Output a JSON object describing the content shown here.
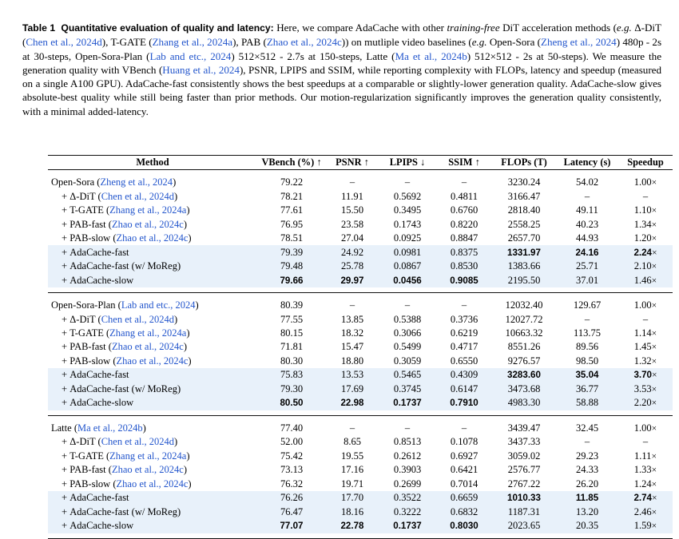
{
  "caption": {
    "label": "Table 1",
    "title": "Quantitative evaluation of quality and latency:",
    "body_html": "Here, we compare AdaCache with other <i>training-free</i> DiT acceleration methods (<i>e.g.</i> Δ-DiT (<c>Chen et al., 2024d</c>), T-GATE (<c>Zhang et al., 2024a</c>), PAB (<c>Zhao et al., 2024c</c>)) on mutliple video baselines (<i>e.g.</i> Open-Sora (<c>Zheng et al., 2024</c>) 480p - 2s at 30-steps, Open-Sora-Plan (<c>Lab and etc., 2024</c>) 512×512 - 2.7s at 150-steps, Latte (<c>Ma et al., 2024b</c>) 512×512 - 2s at 50-steps). We measure the generation quality with VBench (<c>Huang et al., 2024</c>), PSNR, LPIPS and SSIM, while reporting complexity with FLOPs, latency and speedup (measured on a single A100 GPU). AdaCache-fast consistently shows the best speedups at a comparable or slightly-lower generation quality. AdaCache-slow gives absolute-best quality while still being faster than prior methods. Our motion-regularization significantly improves the generation quality consistently, with a minimal added-latency.",
    "citation_color": "#2255cc"
  },
  "table": {
    "columns": [
      {
        "key": "method",
        "label": "Method",
        "align": "left"
      },
      {
        "key": "vbench",
        "label": "VBench (%) ↑",
        "align": "center"
      },
      {
        "key": "psnr",
        "label": "PSNR ↑",
        "align": "center"
      },
      {
        "key": "lpips",
        "label": "LPIPS ↓",
        "align": "center"
      },
      {
        "key": "ssim",
        "label": "SSIM ↑",
        "align": "center"
      },
      {
        "key": "flops",
        "label": "FLOPs (T)",
        "align": "center"
      },
      {
        "key": "latency",
        "label": "Latency (s)",
        "align": "center"
      },
      {
        "key": "speedup",
        "label": "Speedup",
        "align": "center"
      }
    ],
    "highlight_color": "#e8f1fa",
    "blocks": [
      {
        "id": "open-sora",
        "rows": [
          {
            "method_name": "Open-Sora",
            "method_cite": "Zheng et al., 2024",
            "indent": false,
            "plus": false,
            "vbench": "79.22",
            "psnr": "–",
            "lpips": "–",
            "ssim": "–",
            "flops": "3230.24",
            "latency": "54.02",
            "speedup": "1.00×",
            "highlight": false,
            "bold": []
          },
          {
            "method_name": "Δ-DiT",
            "method_cite": "Chen et al., 2024d",
            "indent": true,
            "plus": true,
            "vbench": "78.21",
            "psnr": "11.91",
            "lpips": "0.5692",
            "ssim": "0.4811",
            "flops": "3166.47",
            "latency": "–",
            "speedup": "–",
            "highlight": false,
            "bold": []
          },
          {
            "method_name": "T-GATE",
            "method_cite": "Zhang et al., 2024a",
            "indent": true,
            "plus": true,
            "vbench": "77.61",
            "psnr": "15.50",
            "lpips": "0.3495",
            "ssim": "0.6760",
            "flops": "2818.40",
            "latency": "49.11",
            "speedup": "1.10×",
            "highlight": false,
            "bold": []
          },
          {
            "method_name": "PAB-fast",
            "method_cite": "Zhao et al., 2024c",
            "indent": true,
            "plus": true,
            "vbench": "76.95",
            "psnr": "23.58",
            "lpips": "0.1743",
            "ssim": "0.8220",
            "flops": "2558.25",
            "latency": "40.23",
            "speedup": "1.34×",
            "highlight": false,
            "bold": []
          },
          {
            "method_name": "PAB-slow",
            "method_cite": "Zhao et al., 2024c",
            "indent": true,
            "plus": true,
            "vbench": "78.51",
            "psnr": "27.04",
            "lpips": "0.0925",
            "ssim": "0.8847",
            "flops": "2657.70",
            "latency": "44.93",
            "speedup": "1.20×",
            "highlight": false,
            "bold": []
          },
          {
            "method_name": "AdaCache-fast",
            "method_cite": "",
            "indent": true,
            "plus": true,
            "vbench": "79.39",
            "psnr": "24.92",
            "lpips": "0.0981",
            "ssim": "0.8375",
            "flops": "1331.97",
            "latency": "24.16",
            "speedup": "2.24×",
            "highlight": true,
            "bold": [
              "flops",
              "latency",
              "speedup"
            ]
          },
          {
            "method_name": "AdaCache-fast (w/ MoReg)",
            "method_cite": "",
            "indent": true,
            "plus": true,
            "vbench": "79.48",
            "psnr": "25.78",
            "lpips": "0.0867",
            "ssim": "0.8530",
            "flops": "1383.66",
            "latency": "25.71",
            "speedup": "2.10×",
            "highlight": true,
            "bold": []
          },
          {
            "method_name": "AdaCache-slow",
            "method_cite": "",
            "indent": true,
            "plus": true,
            "vbench": "79.66",
            "psnr": "29.97",
            "lpips": "0.0456",
            "ssim": "0.9085",
            "flops": "2195.50",
            "latency": "37.01",
            "speedup": "1.46×",
            "highlight": true,
            "bold": [
              "vbench",
              "psnr",
              "lpips",
              "ssim"
            ]
          }
        ]
      },
      {
        "id": "open-sora-plan",
        "rows": [
          {
            "method_name": "Open-Sora-Plan",
            "method_cite": "Lab and etc., 2024",
            "indent": false,
            "plus": false,
            "vbench": "80.39",
            "psnr": "–",
            "lpips": "–",
            "ssim": "–",
            "flops": "12032.40",
            "latency": "129.67",
            "speedup": "1.00×",
            "highlight": false,
            "bold": []
          },
          {
            "method_name": "Δ-DiT",
            "method_cite": "Chen et al., 2024d",
            "indent": true,
            "plus": true,
            "vbench": "77.55",
            "psnr": "13.85",
            "lpips": "0.5388",
            "ssim": "0.3736",
            "flops": "12027.72",
            "latency": "–",
            "speedup": "–",
            "highlight": false,
            "bold": []
          },
          {
            "method_name": "T-GATE",
            "method_cite": "Zhang et al., 2024a",
            "indent": true,
            "plus": true,
            "vbench": "80.15",
            "psnr": "18.32",
            "lpips": "0.3066",
            "ssim": "0.6219",
            "flops": "10663.32",
            "latency": "113.75",
            "speedup": "1.14×",
            "highlight": false,
            "bold": []
          },
          {
            "method_name": "PAB-fast",
            "method_cite": "Zhao et al., 2024c",
            "indent": true,
            "plus": true,
            "vbench": "71.81",
            "psnr": "15.47",
            "lpips": "0.5499",
            "ssim": "0.4717",
            "flops": "8551.26",
            "latency": "89.56",
            "speedup": "1.45×",
            "highlight": false,
            "bold": []
          },
          {
            "method_name": "PAB-slow",
            "method_cite": "Zhao et al., 2024c",
            "indent": true,
            "plus": true,
            "vbench": "80.30",
            "psnr": "18.80",
            "lpips": "0.3059",
            "ssim": "0.6550",
            "flops": "9276.57",
            "latency": "98.50",
            "speedup": "1.32×",
            "highlight": false,
            "bold": []
          },
          {
            "method_name": "AdaCache-fast",
            "method_cite": "",
            "indent": true,
            "plus": true,
            "vbench": "75.83",
            "psnr": "13.53",
            "lpips": "0.5465",
            "ssim": "0.4309",
            "flops": "3283.60",
            "latency": "35.04",
            "speedup": "3.70×",
            "highlight": true,
            "bold": [
              "flops",
              "latency",
              "speedup"
            ]
          },
          {
            "method_name": "AdaCache-fast (w/ MoReg)",
            "method_cite": "",
            "indent": true,
            "plus": true,
            "vbench": "79.30",
            "psnr": "17.69",
            "lpips": "0.3745",
            "ssim": "0.6147",
            "flops": "3473.68",
            "latency": "36.77",
            "speedup": "3.53×",
            "highlight": true,
            "bold": []
          },
          {
            "method_name": "AdaCache-slow",
            "method_cite": "",
            "indent": true,
            "plus": true,
            "vbench": "80.50",
            "psnr": "22.98",
            "lpips": "0.1737",
            "ssim": "0.7910",
            "flops": "4983.30",
            "latency": "58.88",
            "speedup": "2.20×",
            "highlight": true,
            "bold": [
              "vbench",
              "psnr",
              "lpips",
              "ssim"
            ]
          }
        ]
      },
      {
        "id": "latte",
        "rows": [
          {
            "method_name": "Latte",
            "method_cite": "Ma et al., 2024b",
            "indent": false,
            "plus": false,
            "vbench": "77.40",
            "psnr": "–",
            "lpips": "–",
            "ssim": "–",
            "flops": "3439.47",
            "latency": "32.45",
            "speedup": "1.00×",
            "highlight": false,
            "bold": []
          },
          {
            "method_name": "Δ-DiT",
            "method_cite": "Chen et al., 2024d",
            "indent": true,
            "plus": true,
            "vbench": "52.00",
            "psnr": "8.65",
            "lpips": "0.8513",
            "ssim": "0.1078",
            "flops": "3437.33",
            "latency": "–",
            "speedup": "–",
            "highlight": false,
            "bold": []
          },
          {
            "method_name": "T-GATE",
            "method_cite": "Zhang et al., 2024a",
            "indent": true,
            "plus": true,
            "vbench": "75.42",
            "psnr": "19.55",
            "lpips": "0.2612",
            "ssim": "0.6927",
            "flops": "3059.02",
            "latency": "29.23",
            "speedup": "1.11×",
            "highlight": false,
            "bold": []
          },
          {
            "method_name": "PAB-fast",
            "method_cite": "Zhao et al., 2024c",
            "indent": true,
            "plus": true,
            "vbench": "73.13",
            "psnr": "17.16",
            "lpips": "0.3903",
            "ssim": "0.6421",
            "flops": "2576.77",
            "latency": "24.33",
            "speedup": "1.33×",
            "highlight": false,
            "bold": []
          },
          {
            "method_name": "PAB-slow",
            "method_cite": "Zhao et al., 2024c",
            "indent": true,
            "plus": true,
            "vbench": "76.32",
            "psnr": "19.71",
            "lpips": "0.2699",
            "ssim": "0.7014",
            "flops": "2767.22",
            "latency": "26.20",
            "speedup": "1.24×",
            "highlight": false,
            "bold": []
          },
          {
            "method_name": "AdaCache-fast",
            "method_cite": "",
            "indent": true,
            "plus": true,
            "vbench": "76.26",
            "psnr": "17.70",
            "lpips": "0.3522",
            "ssim": "0.6659",
            "flops": "1010.33",
            "latency": "11.85",
            "speedup": "2.74×",
            "highlight": true,
            "bold": [
              "flops",
              "latency",
              "speedup"
            ]
          },
          {
            "method_name": "AdaCache-fast (w/ MoReg)",
            "method_cite": "",
            "indent": true,
            "plus": true,
            "vbench": "76.47",
            "psnr": "18.16",
            "lpips": "0.3222",
            "ssim": "0.6832",
            "flops": "1187.31",
            "latency": "13.20",
            "speedup": "2.46×",
            "highlight": true,
            "bold": []
          },
          {
            "method_name": "AdaCache-slow",
            "method_cite": "",
            "indent": true,
            "plus": true,
            "vbench": "77.07",
            "psnr": "22.78",
            "lpips": "0.1737",
            "ssim": "0.8030",
            "flops": "2023.65",
            "latency": "20.35",
            "speedup": "1.59×",
            "highlight": true,
            "bold": [
              "vbench",
              "psnr",
              "lpips",
              "ssim"
            ]
          }
        ]
      }
    ]
  }
}
